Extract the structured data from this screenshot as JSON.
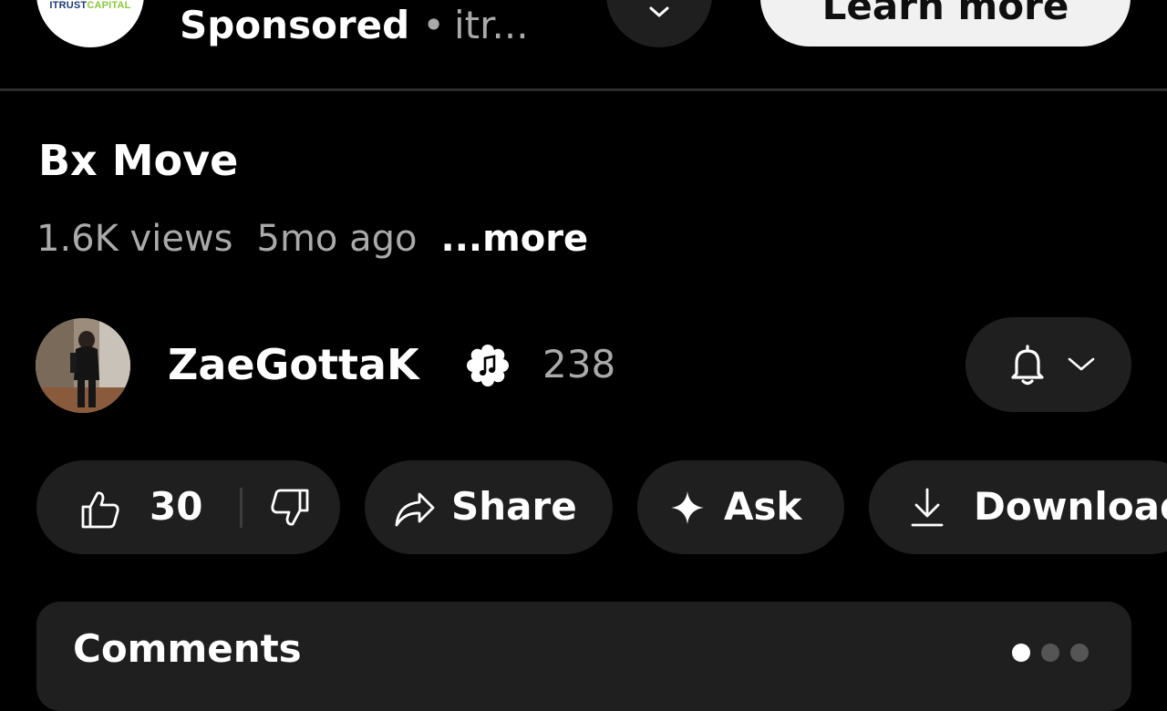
{
  "ad": {
    "logo_text_main": "ITRUST",
    "logo_text_accent": "CAPITAL",
    "sponsored_label": "Sponsored",
    "separator": "•",
    "domain": "itr...",
    "cta_label": "Learn more",
    "menu_icon": "chevron-down-icon"
  },
  "video": {
    "title": "Bx Move",
    "views": "1.6K views",
    "age": "5mo ago",
    "more_label": "...more"
  },
  "channel": {
    "name": "ZaeGottaK",
    "subscriber_count": "238",
    "verified_icon": "music-note-badge-icon",
    "bell_icon": "bell-icon"
  },
  "actions": {
    "like_count": "30",
    "share_label": "Share",
    "ask_label": "Ask",
    "download_label": "Download"
  },
  "comments": {
    "title": "Comments"
  },
  "colors": {
    "background": "#000000",
    "surface": "#1f1f1f",
    "secondary_text": "#aaaaaa",
    "primary_text": "#ffffff",
    "cta_background": "#f1f1f1"
  }
}
